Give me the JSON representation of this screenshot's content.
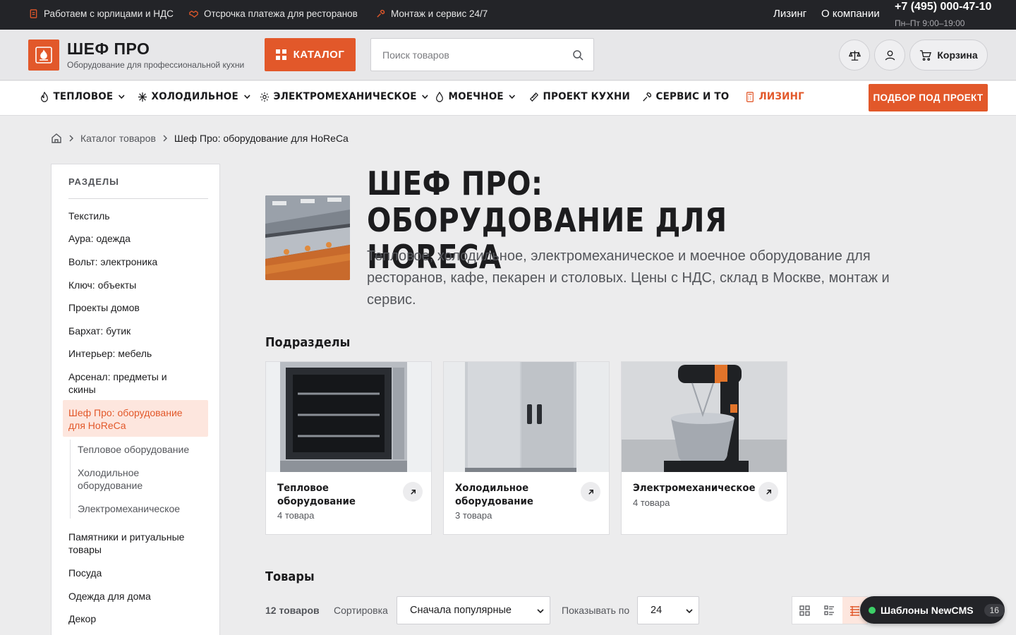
{
  "topbar": {
    "items": [
      {
        "label": "Работаем с юрлицами и НДС",
        "icon": "document-icon"
      },
      {
        "label": "Отсрочка платежа для ресторанов",
        "icon": "handshake-icon"
      },
      {
        "label": "Монтаж и сервис 24/7",
        "icon": "wrench-icon"
      }
    ],
    "links": [
      "Лизинг",
      "О компании"
    ],
    "phone": "+7 (495) 000-47-10",
    "hours": "Пн–Пт 9:00–19:00"
  },
  "header": {
    "logo_name": "ШЕФ ПРО",
    "logo_sub": "Оборудование для профессиональной кухни",
    "catalog_label": "КАТАЛОГ",
    "search_placeholder": "Поиск товаров",
    "cart_label": "Корзина"
  },
  "nav": {
    "items": [
      {
        "label": "ТЕПЛОВОЕ",
        "icon": "flame-icon",
        "dropdown": true
      },
      {
        "label": "ХОЛОДИЛЬНОЕ",
        "icon": "snowflake-icon",
        "dropdown": true
      },
      {
        "label": "ЭЛЕКТРОМЕХАНИЧЕСКОЕ",
        "icon": "gear-icon",
        "dropdown": true
      },
      {
        "label": "МОЕЧНОЕ",
        "icon": "droplet-icon",
        "dropdown": true
      },
      {
        "label": "ПРОЕКТ КУХНИ",
        "icon": "ruler-icon",
        "dropdown": false
      },
      {
        "label": "СЕРВИС И ТО",
        "icon": "wrench-icon",
        "dropdown": false
      },
      {
        "label": "ЛИЗИНГ",
        "icon": "calculator-icon",
        "dropdown": false
      }
    ],
    "cta": "ПОДБОР ПОД ПРОЕКТ",
    "accent_color": "#e2582a"
  },
  "breadcrumbs": {
    "items": [
      "Каталог товаров",
      "Шеф Про: оборудование для HoReCa"
    ]
  },
  "sidebar": {
    "title": "РАЗДЕЛЫ",
    "items": [
      "Текстиль",
      "Аура: одежда",
      "Вольт: электроника",
      "Ключ: объекты",
      "Проекты домов",
      "Бархат: бутик",
      "Интерьер: мебель",
      "Арсенал: предметы и скины",
      "Шеф Про: оборудование для HoReCa",
      "Памятники и ритуальные товары",
      "Посуда",
      "Одежда для дома",
      "Декор"
    ],
    "active_index": 8,
    "subitems": [
      "Тепловое оборудование",
      "Холодильное оборудование",
      "Электромеханическое"
    ]
  },
  "main": {
    "title": "ШЕФ ПРО: ОБОРУДОВАНИЕ ДЛЯ HORECA",
    "description": "Тепловое, холодильное, электромеханическое и моечное оборудование для ресторанов, кафе, пекарен и столовых. Цены с НДС, склад в Москве, монтаж и сервис.",
    "subsections_title": "Подразделы",
    "subsections": [
      {
        "title": "Тепловое оборудование",
        "count": "4 товара"
      },
      {
        "title": "Холодильное оборудование",
        "count": "3 товара"
      },
      {
        "title": "Электромеханическое",
        "count": "4 товара"
      }
    ],
    "products_title": "Товары",
    "products_count": "12 товаров",
    "sort_label": "Сортировка",
    "sort_value": "Сначала популярные",
    "show_label": "Показывать по",
    "show_value": "24"
  },
  "widget": {
    "label": "Шаблоны NewCMS",
    "count": "16"
  }
}
